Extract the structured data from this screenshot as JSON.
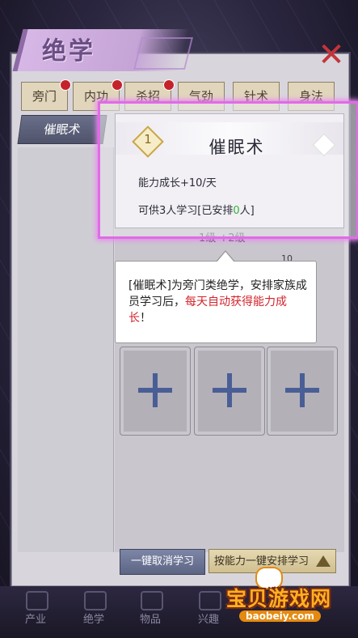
{
  "header": {
    "title": "绝学",
    "close_icon": "close-x-icon"
  },
  "tabs": [
    {
      "label": "旁门",
      "has_alert": true
    },
    {
      "label": "内功",
      "has_alert": true
    },
    {
      "label": "杀招",
      "has_alert": true
    },
    {
      "label": "气劲",
      "has_alert": false
    },
    {
      "label": "针术",
      "has_alert": false
    },
    {
      "label": "身法",
      "has_alert": false
    }
  ],
  "skill_list": {
    "selected": "催眠术"
  },
  "skill_card": {
    "rank": "1",
    "name": "催眠术",
    "growth": "能力成长+10/天",
    "capacity_prefix": "可供3人学习[已安排",
    "capacity_count": "0",
    "capacity_suffix": "人]"
  },
  "level_info": {
    "level_text": "1级 +2级",
    "count_text": "10"
  },
  "tooltip": {
    "prefix": "[催眠术]为旁门类绝学，安排家族成员学习后，",
    "highlight": "每天自动获得能力成长",
    "suffix": "！"
  },
  "slots": [
    {
      "icon": "plus-icon"
    },
    {
      "icon": "plus-icon"
    },
    {
      "icon": "plus-icon"
    }
  ],
  "buttons": {
    "cancel": "一键取消学习",
    "arrange": "按能力一键安排学习"
  },
  "nav": [
    {
      "label": "产业"
    },
    {
      "label": "绝学"
    },
    {
      "label": "物品"
    },
    {
      "label": "兴趣"
    },
    {
      "label": ""
    },
    {
      "label": ""
    }
  ],
  "watermark": {
    "text": "宝贝游戏网",
    "url": "baobeiy.com"
  },
  "colors": {
    "card_border": "#e06ce6",
    "highlight_red": "#d2242c",
    "accent_green": "#34b43c",
    "alert_dot": "#c4232b"
  }
}
